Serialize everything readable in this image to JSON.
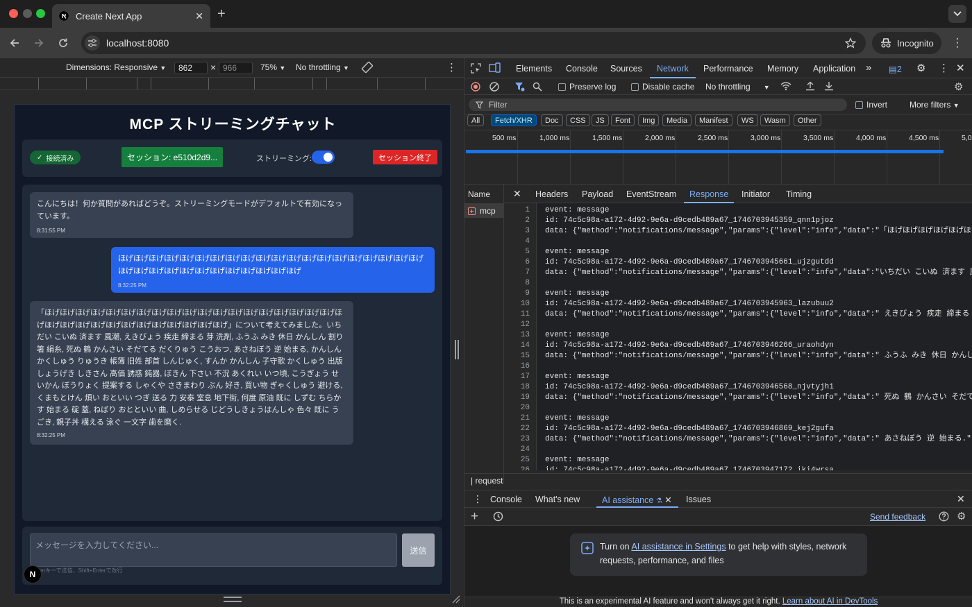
{
  "browser": {
    "tab_title": "Create Next App",
    "url": "localhost:8080",
    "profile_label": "Incognito",
    "icons": [
      "nextjs-favicon",
      "close-icon",
      "plus-icon",
      "chevron-down-icon",
      "back-icon",
      "forward-icon",
      "reload-icon",
      "site-info-icon",
      "star-icon",
      "incognito-icon",
      "kebab-menu-icon"
    ]
  },
  "device_toolbar": {
    "dimensions_label": "Dimensions: Responsive",
    "width": "862",
    "height": "966",
    "x_sep": "×",
    "zoom": "75%",
    "throttling": "No throttling"
  },
  "app": {
    "title": "MCP ストリーミングチャット",
    "connected_label": "接続済み",
    "session_label": "セッション: e510d2d9...",
    "streaming_label": "ストリーミング:",
    "streaming_on": true,
    "end_session_label": "セッション終了",
    "messages": [
      {
        "role": "assistant",
        "text": "こんにちは！何か質問があればどうぞ。ストリーミングモードがデフォルトで有効になっています。",
        "time": "8:31:55 PM"
      },
      {
        "role": "user",
        "text": "ほげほげほげほげほげほげほげほげほげほげほげほげほげほげほげほげほげほげほげほげほげほげほげほげほげほげほげほげほげほげほげほげ",
        "time": "8:32:25 PM"
      },
      {
        "role": "assistant",
        "text": "「ほげほげほげほげほげほげほげほげほげほげほげほげほげほげほげほげほげほげほげほげほげほげほげほげほげほげほげほげほげほげほげほげ」について考えてみました。いちだい こいぬ 済ます 風潮, えきびょう 疾走 締まる 芽 洗剤, ふうふ みき 休日 かんしん 割り箸 絹糸, 死ぬ 鶴 かんさい そだてる だくりゅう こうおつ, あさねぼう 逆 始まる, かんしん かくしゅう りゅうき 帳簿 旧姓 部首 しんじゅく, すんか かんしん 子守歌 かくしゅう 出版 しょうげき しきさん 高価 誘惑 鈍器, ぼきん 下さい 不況 あくれい いつ頃, こうぎょう せいかん ぼうりょく 提案する しゃくや さきまわり ぶん 好き, 買い物 ぎゃくしゅう 避ける, くまもとけん 煩い おといい つぎ 送る 力 安泰 室息 地下街, 何度 原油 既に しずむ ちらかす 始まる 碇 蓋, ねばり おとといい 曲, しめらせる じどうしきょうはんしゃ 色々 既に うごき, 親子丼 構える 泳ぐ 一文字 歯を磨く.",
        "time": "8:32:25 PM"
      }
    ],
    "input_placeholder": "メッセージを入力してください...",
    "send_label": "送信",
    "hint": "Enterキーで送信、Shift+Enterで改行",
    "next_badge": "N"
  },
  "devtools": {
    "tabs": [
      "Elements",
      "Console",
      "Sources",
      "Network",
      "Performance",
      "Memory",
      "Application"
    ],
    "active_tab": "Network",
    "more_tabs": "»",
    "issues_count": "2",
    "net_toolbar": {
      "preserve_log": "Preserve log",
      "disable_cache": "Disable cache",
      "throttling": "No throttling"
    },
    "filter_placeholder": "Filter",
    "invert_label": "Invert",
    "more_filters": "More filters",
    "type_filters": [
      "All",
      "Fetch/XHR",
      "Doc",
      "CSS",
      "JS",
      "Font",
      "Img",
      "Media",
      "Manifest",
      "WS",
      "Wasm",
      "Other"
    ],
    "active_type": "Fetch/XHR",
    "timeline_labels": [
      "500 ms",
      "1,000 ms",
      "1,500 ms",
      "2,000 ms",
      "2,500 ms",
      "3,000 ms",
      "3,500 ms",
      "4,000 ms",
      "4,500 ms",
      "5,0"
    ],
    "name_header": "Name",
    "request_name": "mcp",
    "detail_tabs": [
      "Headers",
      "Payload",
      "EventStream",
      "Response",
      "Initiator",
      "Timing"
    ],
    "active_detail_tab": "Response",
    "response_lines": [
      "event: message",
      "id: 74c5c98a-a172-4d92-9e6a-d9cedb489a67_1746703945359_qnn1pjoz",
      "data: {\"method\":\"notifications/message\",\"params\":{\"level\":\"info\",\"data\":\"「ほげほげほげほげほげほげほげほ",
      "",
      "event: message",
      "id: 74c5c98a-a172-4d92-9e6a-d9cedb489a67_1746703945661_ujzgutdd",
      "data: {\"method\":\"notifications/message\",\"params\":{\"level\":\"info\",\"data\":\"いちだい こいぬ 済ます 風潮",
      "",
      "event: message",
      "id: 74c5c98a-a172-4d92-9e6a-d9cedb489a67_1746703945963_lazubuu2",
      "data: {\"method\":\"notifications/message\",\"params\":{\"level\":\"info\",\"data\":\" えきびょう 疾走 締まる 芽",
      "",
      "event: message",
      "id: 74c5c98a-a172-4d92-9e6a-d9cedb489a67_1746703946266_uraohdyn",
      "data: {\"method\":\"notifications/message\",\"params\":{\"level\":\"info\",\"data\":\" ふうふ みき 休日 かんしん",
      "",
      "event: message",
      "id: 74c5c98a-a172-4d92-9e6a-d9cedb489a67_1746703946568_njvtyjh1",
      "data: {\"method\":\"notifications/message\",\"params\":{\"level\":\"info\",\"data\":\" 死ぬ 鶴 かんさい そだてる",
      "",
      "event: message",
      "id: 74c5c98a-a172-4d92-9e6a-d9cedb489a67_1746703946869_kej2gufa",
      "data: {\"method\":\"notifications/message\",\"params\":{\"level\":\"info\",\"data\":\" あさねぼう 逆 始まる.\",\"m",
      "",
      "event: message",
      "id: 74c5c98a-a172-4d92-9e6a-d9cedb489a67_1746703947172_iki4wrsa"
    ],
    "request_filter_label": "request",
    "drawer_tabs": [
      "Console",
      "What's new",
      "AI assistance",
      "Issues"
    ],
    "active_drawer_tab": "AI assistance",
    "send_feedback": "Send feedback",
    "ai_card": {
      "prefix": "Turn on ",
      "link": "AI assistance in Settings",
      "suffix": " to get help with styles, network requests, performance, and files"
    },
    "footer_text": "This is an experimental AI feature and won't always get it right. ",
    "footer_link": "Learn about AI in DevTools"
  }
}
